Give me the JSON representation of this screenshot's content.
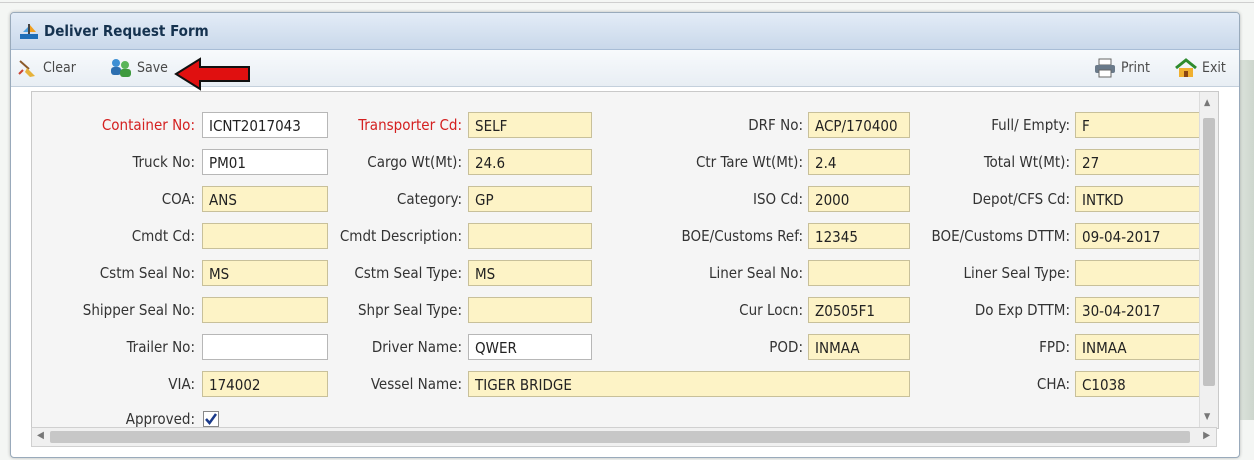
{
  "window": {
    "title": "Deliver Request Form"
  },
  "toolbar": {
    "clear_label": "Clear",
    "save_label": "Save",
    "print_label": "Print",
    "exit_label": "Exit"
  },
  "colors": {
    "required_label": "#d42020",
    "field_bg": "#fdf3c6",
    "editable_bg": "#ffffff"
  },
  "form": {
    "container_no": {
      "label": "Container No:",
      "value": "ICNT2017043"
    },
    "transporter_cd": {
      "label": "Transporter Cd:",
      "value": "SELF"
    },
    "drf_no": {
      "label": "DRF No:",
      "value": "ACP/170400"
    },
    "full_empty": {
      "label": "Full/ Empty:",
      "value": "F"
    },
    "truck_no": {
      "label": "Truck No:",
      "value": "PM01"
    },
    "cargo_wt": {
      "label": "Cargo Wt(Mt):",
      "value": "24.6"
    },
    "ctr_tare_wt": {
      "label": "Ctr Tare Wt(Mt):",
      "value": "2.4"
    },
    "total_wt": {
      "label": "Total Wt(Mt):",
      "value": "27"
    },
    "coa": {
      "label": "COA:",
      "value": "ANS"
    },
    "category": {
      "label": "Category:",
      "value": "GP"
    },
    "iso_cd": {
      "label": "ISO Cd:",
      "value": "2000"
    },
    "depot_cfs_cd": {
      "label": "Depot/CFS Cd:",
      "value": "INTKD"
    },
    "cmdt_cd": {
      "label": "Cmdt Cd:",
      "value": ""
    },
    "cmdt_description": {
      "label": "Cmdt Description:",
      "value": ""
    },
    "boe_customs_ref": {
      "label": "BOE/Customs Ref:",
      "value": "12345"
    },
    "boe_customs_dttm": {
      "label": "BOE/Customs DTTM:",
      "value": "09-04-2017"
    },
    "cstm_seal_no": {
      "label": "Cstm Seal No:",
      "value": "MS"
    },
    "cstm_seal_type": {
      "label": "Cstm Seal Type:",
      "value": "MS"
    },
    "liner_seal_no": {
      "label": "Liner Seal No:",
      "value": ""
    },
    "liner_seal_type": {
      "label": "Liner Seal Type:",
      "value": ""
    },
    "shipper_seal_no": {
      "label": "Shipper Seal No:",
      "value": ""
    },
    "shpr_seal_type": {
      "label": "Shpr Seal Type:",
      "value": ""
    },
    "cur_locn": {
      "label": "Cur Locn:",
      "value": "Z0505F1"
    },
    "do_exp_dttm": {
      "label": "Do Exp DTTM:",
      "value": "30-04-2017"
    },
    "trailer_no": {
      "label": "Trailer No:",
      "value": ""
    },
    "driver_name": {
      "label": "Driver Name:",
      "value": "QWER"
    },
    "pod": {
      "label": "POD:",
      "value": "INMAA"
    },
    "fpd": {
      "label": "FPD:",
      "value": "INMAA"
    },
    "via": {
      "label": "VIA:",
      "value": "174002"
    },
    "vessel_name": {
      "label": "Vessel Name:",
      "value": "TIGER BRIDGE"
    },
    "cha": {
      "label": "CHA:",
      "value": "C1038"
    },
    "approved": {
      "label": "Approved:",
      "checked": true
    }
  }
}
